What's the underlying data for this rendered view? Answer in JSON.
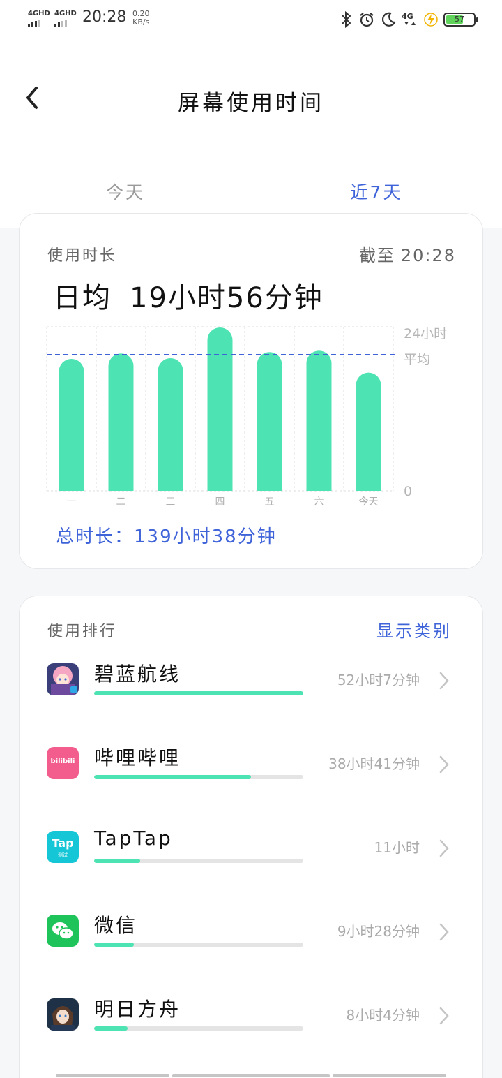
{
  "status_bar": {
    "signal1": "4GHD",
    "signal2": "4GHD",
    "time": "20:28",
    "net_speed_value": "0.20",
    "net_speed_unit": "KB/s",
    "icons": [
      "bluetooth-icon",
      "alarm-icon",
      "moon-icon",
      "4g-data-icon",
      "charging-icon",
      "battery-icon"
    ],
    "battery_level": "57"
  },
  "header": {
    "title": "屏幕使用时间",
    "back_icon": "chevron-left-icon",
    "tabs": [
      {
        "label": "今天",
        "active": false
      },
      {
        "label": "近7天",
        "active": true
      }
    ]
  },
  "usage": {
    "label": "使用时长",
    "cutoff_label": "截至",
    "cutoff_time": "20:28",
    "daily_avg_label": "日均",
    "daily_avg_value": "19小时56分钟",
    "total_label": "总时长：",
    "total_value": "139小时38分钟"
  },
  "chart_data": {
    "type": "bar",
    "categories": [
      "一",
      "二",
      "三",
      "四",
      "五",
      "六",
      "今天"
    ],
    "values": [
      19.3,
      20.1,
      19.4,
      23.9,
      20.3,
      20.5,
      17.3
    ],
    "unit": "小时",
    "ylim": [
      0,
      24
    ],
    "y_tick_labels": [
      "24小时",
      "0"
    ],
    "average_line": {
      "label": "平均",
      "value": 19.93
    },
    "colors": {
      "bar": "#4ee3b2",
      "average_line": "#3f63d9",
      "grid": "#dddddd"
    }
  },
  "ranking": {
    "title": "使用排行",
    "show_category_label": "显示类别",
    "apps": [
      {
        "name": "碧蓝航线",
        "time": "52小时7分钟",
        "fraction": 1.0,
        "icon": "azur-lane-app-icon"
      },
      {
        "name": "哔哩哔哩",
        "time": "38小时41分钟",
        "fraction": 0.75,
        "icon": "bilibili-app-icon",
        "icon_text": "bilibili"
      },
      {
        "name": "TapTap",
        "time": "11小时",
        "fraction": 0.22,
        "icon": "taptap-app-icon",
        "icon_text": "Tap",
        "icon_subtext": "测试"
      },
      {
        "name": "微信",
        "time": "9小时28分钟",
        "fraction": 0.19,
        "icon": "wechat-app-icon"
      },
      {
        "name": "明日方舟",
        "time": "8小时4分钟",
        "fraction": 0.16,
        "icon": "arknights-app-icon"
      }
    ]
  },
  "theme": {
    "accent": "#3f63d9",
    "bar": "#4ee3b2",
    "track": "#e4e4e4"
  }
}
